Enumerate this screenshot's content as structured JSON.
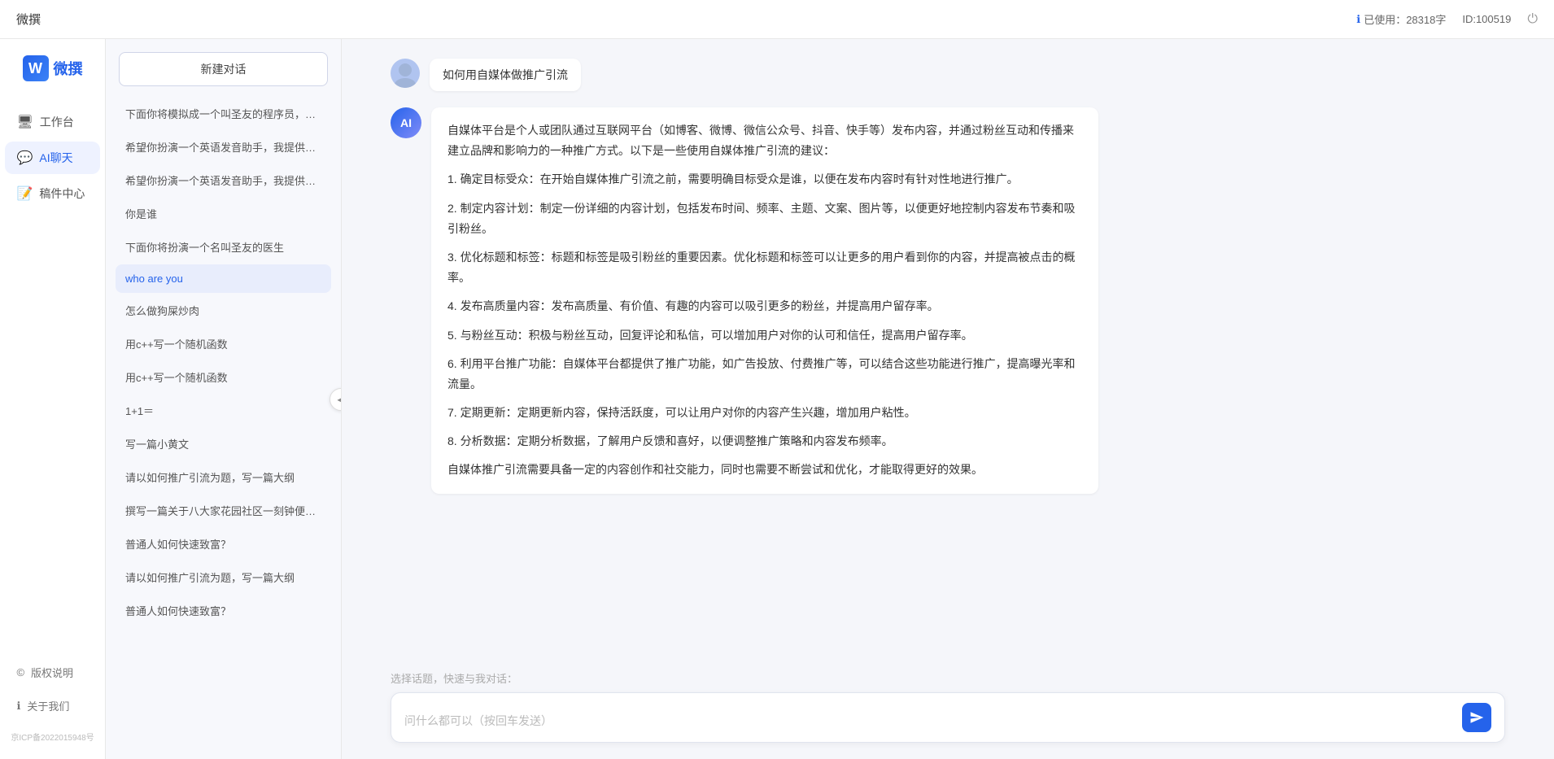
{
  "topbar": {
    "title": "微撰",
    "usage_label": "已使用：28318字",
    "id_label": "ID:100519",
    "info_icon": "ℹ",
    "power_icon": "⏻"
  },
  "logo": {
    "letter": "W",
    "text": "微撰"
  },
  "nav": {
    "items": [
      {
        "id": "workbench",
        "icon": "🖥",
        "label": "工作台"
      },
      {
        "id": "ai-chat",
        "icon": "💬",
        "label": "AI聊天"
      },
      {
        "id": "drafts",
        "icon": "📝",
        "label": "稿件中心"
      }
    ],
    "bottom_items": [
      {
        "id": "copyright",
        "icon": "©",
        "label": "版权说明"
      },
      {
        "id": "about",
        "icon": "ℹ",
        "label": "关于我们"
      }
    ],
    "icp": "京ICP备2022015948号"
  },
  "sidebar": {
    "new_btn": "新建对话",
    "items": [
      {
        "id": "item1",
        "text": "下面你将模拟成一个叫圣友的程序员，我说...",
        "active": false
      },
      {
        "id": "item2",
        "text": "希望你扮演一个英语发音助手，我提供给你...",
        "active": false
      },
      {
        "id": "item3",
        "text": "希望你扮演一个英语发音助手，我提供给你...",
        "active": false
      },
      {
        "id": "item4",
        "text": "你是谁",
        "active": false
      },
      {
        "id": "item5",
        "text": "下面你将扮演一个名叫圣友的医生",
        "active": false
      },
      {
        "id": "item6",
        "text": "who are you",
        "active": true
      },
      {
        "id": "item7",
        "text": "怎么做狗屎炒肉",
        "active": false
      },
      {
        "id": "item8",
        "text": "用c++写一个随机函数",
        "active": false
      },
      {
        "id": "item9",
        "text": "用c++写一个随机函数",
        "active": false
      },
      {
        "id": "item10",
        "text": "1+1＝",
        "active": false
      },
      {
        "id": "item11",
        "text": "写一篇小黄文",
        "active": false
      },
      {
        "id": "item12",
        "text": "请以如何推广引流为题，写一篇大纲",
        "active": false
      },
      {
        "id": "item13",
        "text": "撰写一篇关于八大家花园社区一刻钟便民生...",
        "active": false
      },
      {
        "id": "item14",
        "text": "普通人如何快速致富？",
        "active": false
      },
      {
        "id": "item15",
        "text": "请以如何推广引流为题，写一篇大纲",
        "active": false
      },
      {
        "id": "item16",
        "text": "普通人如何快速致富？",
        "active": false
      }
    ]
  },
  "chat": {
    "user_question": "如何用自媒体做推广引流",
    "ai_response": {
      "paragraphs": [
        "自媒体平台是个人或团队通过互联网平台（如博客、微博、微信公众号、抖音、快手等）发布内容，并通过粉丝互动和传播来建立品牌和影响力的一种推广方式。以下是一些使用自媒体推广引流的建议：",
        "1. 确定目标受众：在开始自媒体推广引流之前，需要明确目标受众是谁，以便在发布内容时有针对性地进行推广。",
        "2. 制定内容计划：制定一份详细的内容计划，包括发布时间、频率、主题、文案、图片等，以便更好地控制内容发布节奏和吸引粉丝。",
        "3. 优化标题和标签：标题和标签是吸引粉丝的重要因素。优化标题和标签可以让更多的用户看到你的内容，并提高被点击的概率。",
        "4. 发布高质量内容：发布高质量、有价值、有趣的内容可以吸引更多的粉丝，并提高用户留存率。",
        "5. 与粉丝互动：积极与粉丝互动，回复评论和私信，可以增加用户对你的认可和信任，提高用户留存率。",
        "6. 利用平台推广功能：自媒体平台都提供了推广功能，如广告投放、付费推广等，可以结合这些功能进行推广，提高曝光率和流量。",
        "7. 定期更新：定期更新内容，保持活跃度，可以让用户对你的内容产生兴趣，增加用户粘性。",
        "8. 分析数据：定期分析数据，了解用户反馈和喜好，以便调整推广策略和内容发布频率。",
        "自媒体推广引流需要具备一定的内容创作和社交能力，同时也需要不断尝试和优化，才能取得更好的效果。"
      ]
    },
    "quick_prompts_label": "选择话题，快速与我对话：",
    "input_placeholder": "问什么都可以（按回车发送）"
  }
}
